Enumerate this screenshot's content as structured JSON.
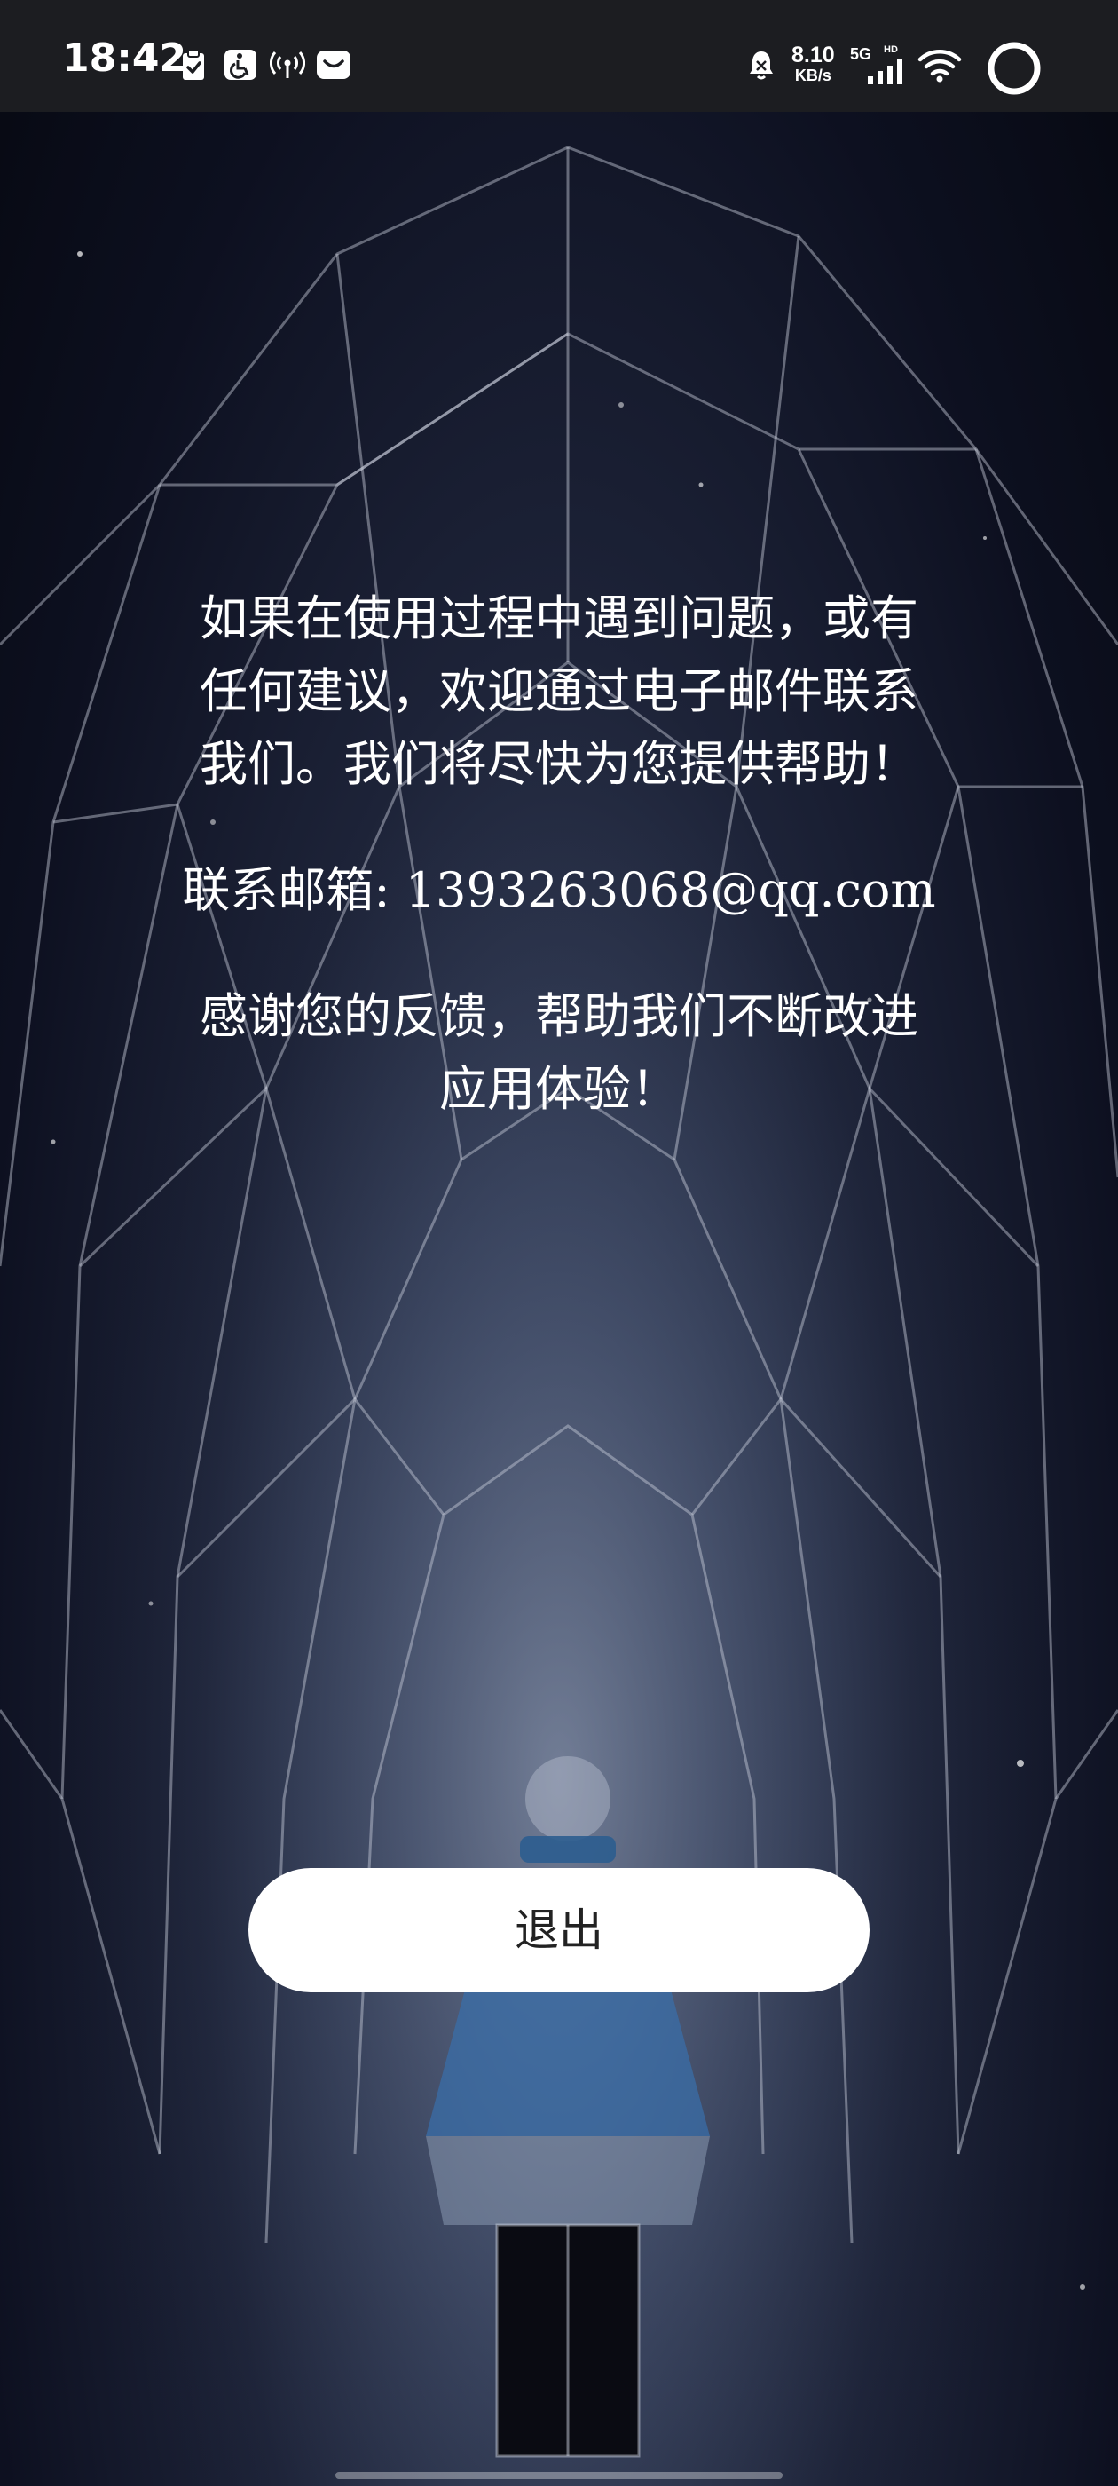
{
  "status_bar": {
    "time": "18:42",
    "left_icons": [
      "clipboard-check-icon",
      "accessibility-icon",
      "hotspot-icon",
      "message-icon"
    ],
    "right_icons": [
      "alarm-icon",
      "signal-icon",
      "wifi-icon",
      "circle-icon"
    ],
    "net_speed_value": "8.10",
    "net_speed_unit": "KB/s",
    "network_type": "5G",
    "network_hd": "HD"
  },
  "content": {
    "message": "如果在使用过程中遇到问题，或有任何建议，欢迎通过电子邮件联系我们。我们将尽快为您提供帮助！",
    "contact": "联系邮箱: 1393263068@qq.com",
    "thanks": "感谢您的反馈，帮助我们不断改进应用体验！"
  },
  "actions": {
    "exit_label": "退出"
  },
  "colors": {
    "status_bar_bg": "#1c1d21",
    "background_top": "#0d1020",
    "background_glow": "#54607a",
    "button_bg": "#ffffff",
    "button_text": "#222222",
    "text": "#ffffff"
  }
}
